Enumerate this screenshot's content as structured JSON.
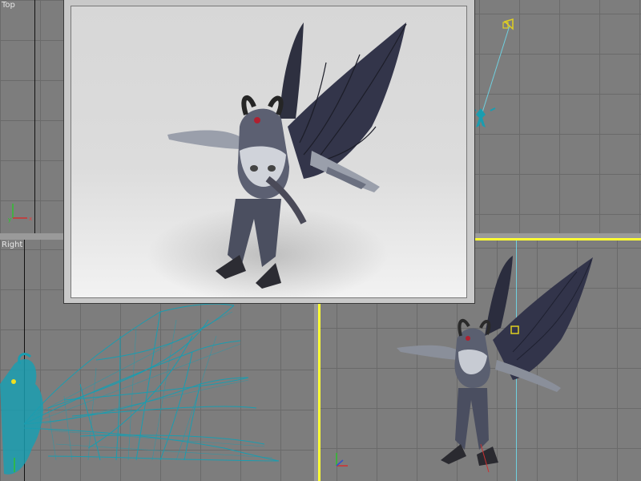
{
  "viewports": {
    "top": {
      "label": "Top"
    },
    "right": {
      "label": "Right"
    },
    "camera": {
      "label": ""
    },
    "perspective": {
      "label": ""
    }
  },
  "colors": {
    "grid_bg": "#7d7d7d",
    "grid_line": "#6a6a6a",
    "active_border": "#ffff33",
    "wireframe": "#1a9db0",
    "render_bg": "#dcdcdc"
  },
  "scene": {
    "model": "winged-demon-character",
    "render_window": "rendered-frame"
  }
}
